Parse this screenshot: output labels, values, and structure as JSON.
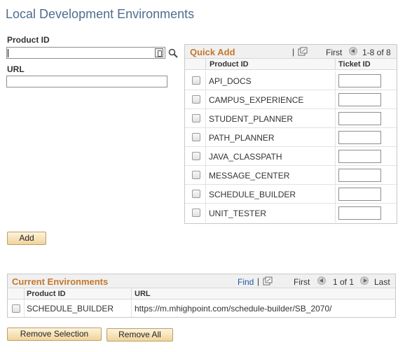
{
  "page": {
    "title": "Local Development Environments"
  },
  "form": {
    "product_id_label": "Product ID",
    "product_id_value": "",
    "url_label": "URL",
    "url_value": ""
  },
  "quick_add": {
    "title": "Quick Add",
    "nav": {
      "first": "First",
      "range": "1-8 of 8"
    },
    "columns": [
      "Product ID",
      "Ticket ID"
    ],
    "rows": [
      {
        "product_id": "API_DOCS",
        "ticket_id": "",
        "checked": false
      },
      {
        "product_id": "CAMPUS_EXPERIENCE",
        "ticket_id": "",
        "checked": false
      },
      {
        "product_id": "STUDENT_PLANNER",
        "ticket_id": "",
        "checked": false
      },
      {
        "product_id": "PATH_PLANNER",
        "ticket_id": "",
        "checked": false
      },
      {
        "product_id": "JAVA_CLASSPATH",
        "ticket_id": "",
        "checked": false
      },
      {
        "product_id": "MESSAGE_CENTER",
        "ticket_id": "",
        "checked": false
      },
      {
        "product_id": "SCHEDULE_BUILDER",
        "ticket_id": "",
        "checked": false
      },
      {
        "product_id": "UNIT_TESTER",
        "ticket_id": "",
        "checked": false
      }
    ]
  },
  "add_button": {
    "label": "Add"
  },
  "current": {
    "title": "Current Environments",
    "nav": {
      "find": "Find",
      "first": "First",
      "range": "1 of 1",
      "last": "Last"
    },
    "columns": [
      "Product ID",
      "URL"
    ],
    "rows": [
      {
        "product_id": "SCHEDULE_BUILDER",
        "url": "https://m.mhighpoint.com/schedule-builder/SB_2070/",
        "checked": false
      }
    ]
  },
  "actions": {
    "remove_selection": "Remove Selection",
    "remove_all": "Remove All"
  },
  "colors": {
    "title": "#4d6e8f",
    "grid_title": "#c5772a",
    "link": "#2158a4",
    "button": "#f2d499"
  },
  "icons": [
    "lookup-icon",
    "search-icon",
    "popout-icon",
    "nav-previous-icon",
    "nav-next-icon"
  ]
}
